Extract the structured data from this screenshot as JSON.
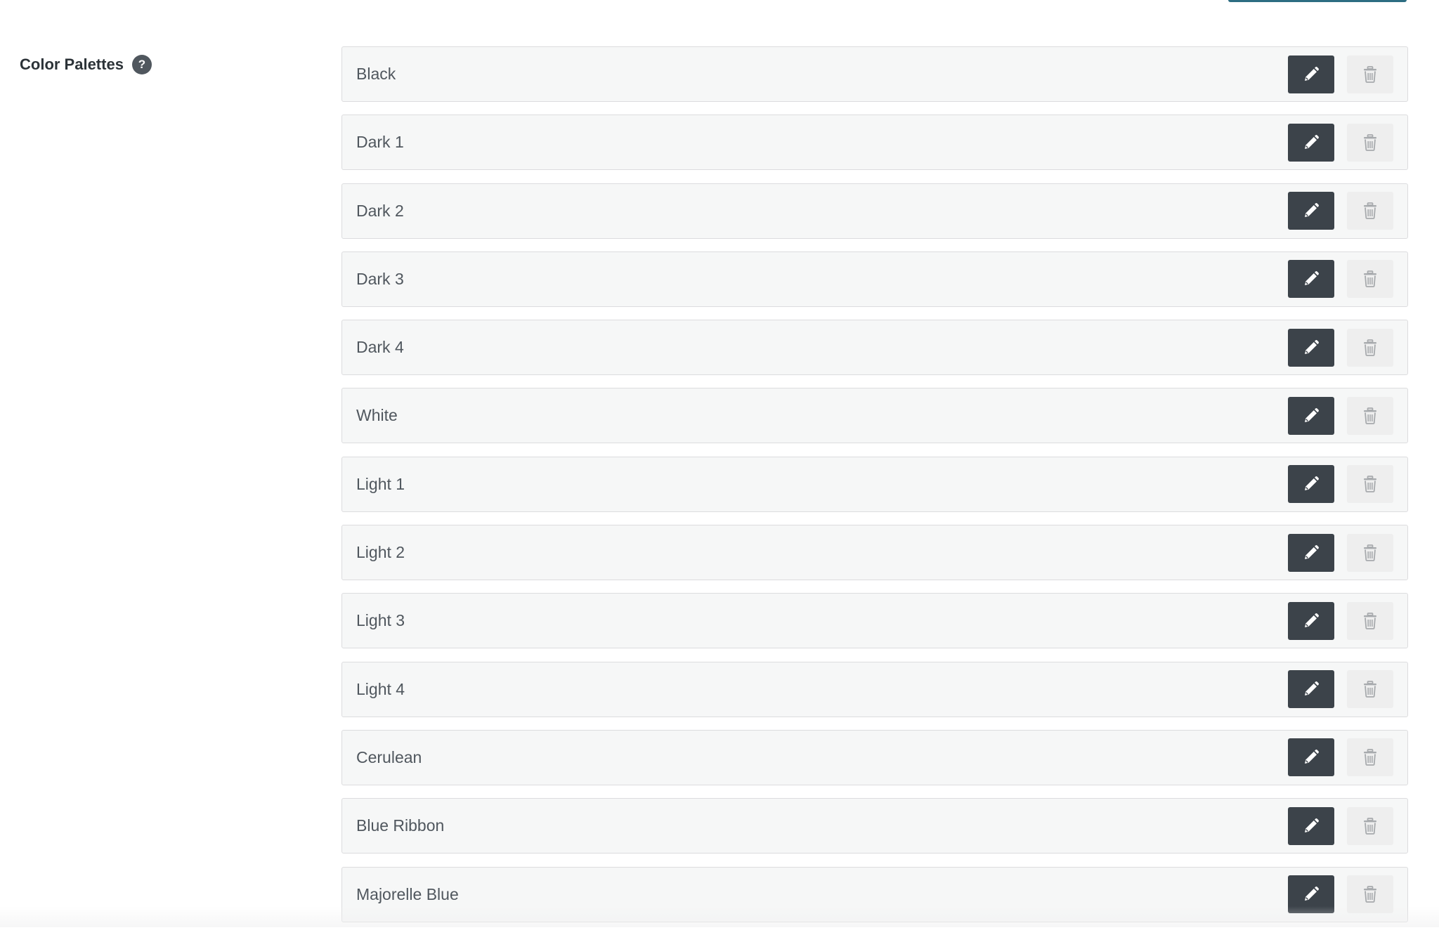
{
  "setting": {
    "label": "Color Palettes",
    "help_glyph": "?"
  },
  "palettes": [
    {
      "name": "Black"
    },
    {
      "name": "Dark 1"
    },
    {
      "name": "Dark 2"
    },
    {
      "name": "Dark 3"
    },
    {
      "name": "Dark 4"
    },
    {
      "name": "White"
    },
    {
      "name": "Light 1"
    },
    {
      "name": "Light 2"
    },
    {
      "name": "Light 3"
    },
    {
      "name": "Light 4"
    },
    {
      "name": "Cerulean"
    },
    {
      "name": "Blue Ribbon"
    },
    {
      "name": "Majorelle Blue"
    }
  ],
  "icons": {
    "edit": "pencil-icon",
    "delete": "trash-icon",
    "help": "question-icon"
  },
  "colors": {
    "edit_button_bg": "#3c434a",
    "delete_button_bg": "#eeeeee",
    "row_bg": "#f6f7f7",
    "row_border": "#dcdcde",
    "accent": "#2d6d82"
  }
}
